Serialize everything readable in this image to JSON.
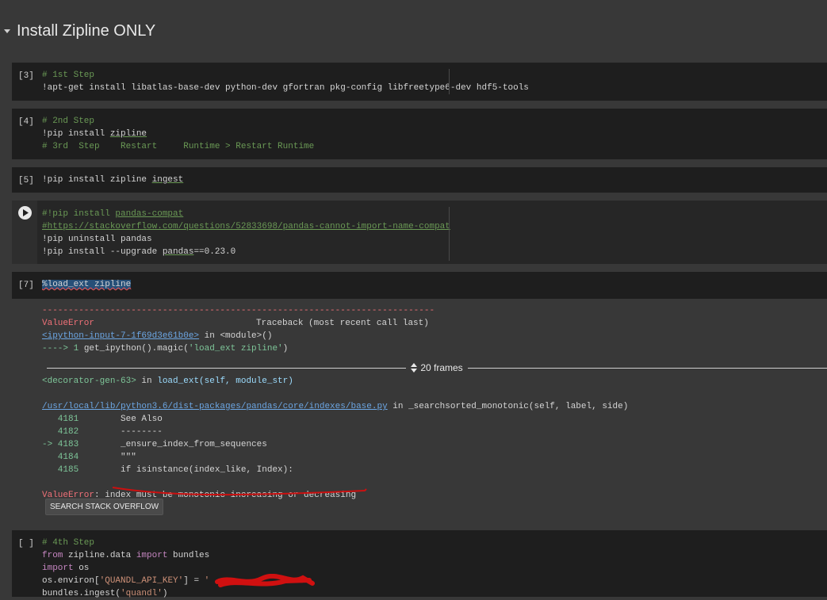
{
  "section": {
    "title": "Install Zipline ONLY"
  },
  "cells": [
    {
      "prompt": "[3]",
      "lines": [
        "# 1st Step",
        "!apt-get install libatlas-base-dev python-dev gfortran pkg-config libfreetype6-dev hdf5-tools"
      ]
    },
    {
      "prompt": "[4]",
      "lines": [
        "# 2nd Step",
        "!pip install ",
        "zipline",
        "# 3rd  Step    Restart     Runtime > Restart Runtime"
      ]
    },
    {
      "prompt": "[5]",
      "lines": [
        "!pip install zipline ",
        "ingest"
      ]
    },
    {
      "prompt": "",
      "lines": [
        "#!pip install ",
        "pandas-compat",
        "#https://stackoverflow.com/questions/52833698/pandas-cannot-import-name-compat",
        "!pip uninstall pandas",
        "!pip install --upgrade ",
        "pandas",
        "==0.23.0"
      ]
    },
    {
      "prompt": "[7]",
      "lines": [
        "%load_ext zipline"
      ]
    },
    {
      "prompt": "[ ]",
      "lines": [
        "# 4th Step",
        "from",
        " zipline.data ",
        "import",
        " bundles",
        "import",
        " os",
        "os.environ[",
        "'QUANDL_API_KEY'",
        "] = ",
        "'",
        "bundles.ingest(",
        "'quandl'",
        ")"
      ]
    }
  ],
  "traceback": {
    "separator": "---------------------------------------------------------------------------",
    "error_name": "ValueError",
    "header_right": "Traceback (most recent call last)",
    "input_link": "<ipython-input-7-1f69d3e61b0e>",
    "in_module": " in <module>()",
    "arrow_line_prefix": "----> 1 ",
    "arrow_line_call": "get_ipython().magic(",
    "arrow_line_arg": "'load_ext zipline'",
    "arrow_line_close": ")",
    "frames_label": "20 frames",
    "decorator": "<decorator-gen-63>",
    "decorator_in": " in ",
    "decorator_fn": "load_ext(self, module_str)",
    "file_link": "/usr/local/lib/python3.6/dist-packages/pandas/core/indexes/base.py",
    "file_in": " in _searchsorted_monotonic(self, label, side)",
    "code_lines": [
      {
        "num": "   4181",
        "text": "        See Also"
      },
      {
        "num": "   4182",
        "text": "        --------"
      },
      {
        "num": "-> 4183",
        "text": "        _ensure_index_from_sequences"
      },
      {
        "num": "   4184",
        "text": "        \"\"\""
      },
      {
        "num": "   4185",
        "text": "        if isinstance(index_like, Index):"
      }
    ],
    "final_error": "ValueError",
    "final_message": ": index must be monotonic increasing or decreasing",
    "button_label": "SEARCH STACK OVERFLOW"
  }
}
